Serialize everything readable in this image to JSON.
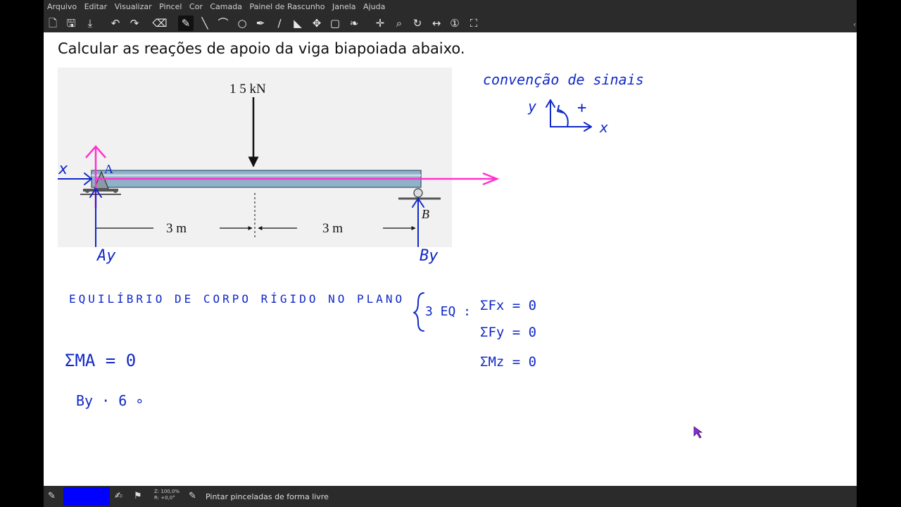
{
  "menu": [
    "Arquivo",
    "Editar",
    "Visualizar",
    "Pincel",
    "Cor",
    "Camada",
    "Painel de Rascunho",
    "Janela",
    "Ajuda"
  ],
  "toolbar_icons": [
    "new-file-icon",
    "save-icon",
    "export-icon",
    "undo-icon",
    "redo-icon",
    "eraser-icon",
    "brush-icon",
    "line-icon",
    "arc-icon",
    "ellipse-icon",
    "pen-icon",
    "color-picker-icon",
    "fill-icon",
    "move-icon",
    "rectangle-icon",
    "symmetry-icon",
    "pan-icon",
    "zoom-icon",
    "rotate-icon",
    "flip-icon",
    "actual-size-icon",
    "fit-icon"
  ],
  "heading": "Calcular as reações de apoio da viga biapoiada abaixo.",
  "figure": {
    "load": "1 5 kN",
    "point_a": "A",
    "point_b": "B",
    "span_left": "3 m",
    "span_right": "3 m"
  },
  "annotations": {
    "ax": "Ax",
    "ay": "Ay",
    "by": "By",
    "sign_convention": "convenção de sinais",
    "axis_y": "y",
    "axis_x": "x",
    "plus": "+",
    "equilibrium": "EQUILÍBRIO DE CORPO RÍGIDO NO PLANO",
    "three_eq": "3 EQ :",
    "eq_fx": "ΣFx = 0",
    "eq_fy": "ΣFy = 0",
    "eq_mz": "ΣMz = 0",
    "moment_a": "ΣMA = 0",
    "by_6": "By · 6 ∘"
  },
  "statusbar": {
    "zoom": "Z: 100,0%",
    "rotation": "R: +0,0°",
    "brush_color": "#0000ff",
    "message": "Pintar pinceladas de forma livre"
  },
  "colors": {
    "ink": "#1028c8",
    "magenta": "#ff33cc",
    "chrome": "#2b2b2b"
  }
}
